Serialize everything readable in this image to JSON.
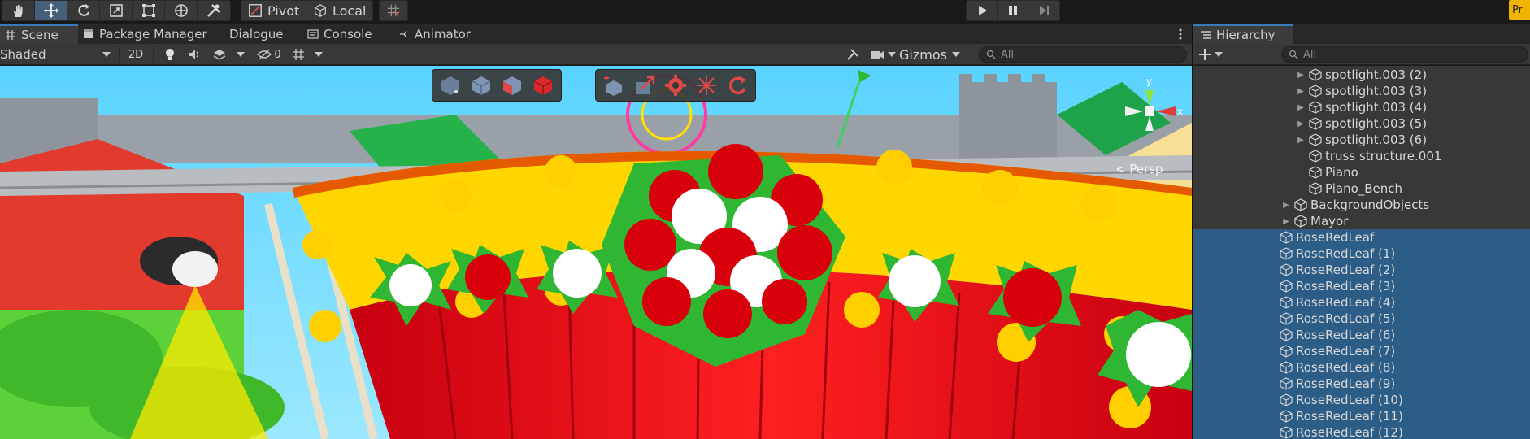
{
  "toolbar": {
    "tools": [
      "hand-tool",
      "move-tool",
      "rotate-tool",
      "scale-tool",
      "rect-tool",
      "transform-tool",
      "custom-tool"
    ],
    "pivot_label": "Pivot",
    "local_label": "Local",
    "corner_badge": "Pr"
  },
  "scene_tabs": [
    "Scene",
    "Package Manager",
    "Dialogue",
    "Console",
    "Animator"
  ],
  "scene_bar": {
    "shading_mode": "Shaded",
    "mode_2d": "2D",
    "hidden_count": "0",
    "gizmos_label": "Gizmos",
    "search_placeholder": "All"
  },
  "viewport": {
    "persp_label": "< Persp",
    "axis_y": "y",
    "axis_x": "x"
  },
  "hierarchy": {
    "tab_label": "Hierarchy",
    "search_placeholder": "All",
    "items": [
      {
        "label": "spotlight.003 (2)",
        "indent": 3,
        "expandable": true,
        "selected": false
      },
      {
        "label": "spotlight.003 (3)",
        "indent": 3,
        "expandable": true,
        "selected": false
      },
      {
        "label": "spotlight.003 (4)",
        "indent": 3,
        "expandable": true,
        "selected": false
      },
      {
        "label": "spotlight.003 (5)",
        "indent": 3,
        "expandable": true,
        "selected": false
      },
      {
        "label": "spotlight.003 (6)",
        "indent": 3,
        "expandable": true,
        "selected": false
      },
      {
        "label": "truss structure.001",
        "indent": 3,
        "expandable": false,
        "selected": false
      },
      {
        "label": "Piano",
        "indent": 3,
        "expandable": false,
        "selected": false
      },
      {
        "label": "Piano_Bench",
        "indent": 3,
        "expandable": false,
        "selected": false
      },
      {
        "label": "BackgroundObjects",
        "indent": 2,
        "expandable": true,
        "selected": false
      },
      {
        "label": "Mayor",
        "indent": 2,
        "expandable": true,
        "selected": false
      },
      {
        "label": "RoseRedLeaf",
        "indent": 1,
        "expandable": false,
        "selected": true
      },
      {
        "label": "RoseRedLeaf (1)",
        "indent": 1,
        "expandable": false,
        "selected": true
      },
      {
        "label": "RoseRedLeaf (2)",
        "indent": 1,
        "expandable": false,
        "selected": true
      },
      {
        "label": "RoseRedLeaf (3)",
        "indent": 1,
        "expandable": false,
        "selected": true
      },
      {
        "label": "RoseRedLeaf (4)",
        "indent": 1,
        "expandable": false,
        "selected": true
      },
      {
        "label": "RoseRedLeaf (5)",
        "indent": 1,
        "expandable": false,
        "selected": true
      },
      {
        "label": "RoseRedLeaf (6)",
        "indent": 1,
        "expandable": false,
        "selected": true
      },
      {
        "label": "RoseRedLeaf (7)",
        "indent": 1,
        "expandable": false,
        "selected": true
      },
      {
        "label": "RoseRedLeaf (8)",
        "indent": 1,
        "expandable": false,
        "selected": true
      },
      {
        "label": "RoseRedLeaf (9)",
        "indent": 1,
        "expandable": false,
        "selected": true
      },
      {
        "label": "RoseRedLeaf (10)",
        "indent": 1,
        "expandable": false,
        "selected": true
      },
      {
        "label": "RoseRedLeaf (11)",
        "indent": 1,
        "expandable": false,
        "selected": true
      },
      {
        "label": "RoseRedLeaf (12)",
        "indent": 1,
        "expandable": false,
        "selected": true
      }
    ]
  },
  "colors": {
    "selection": "#2c5d87",
    "accent": "#3a79bb",
    "panel": "#383838"
  }
}
